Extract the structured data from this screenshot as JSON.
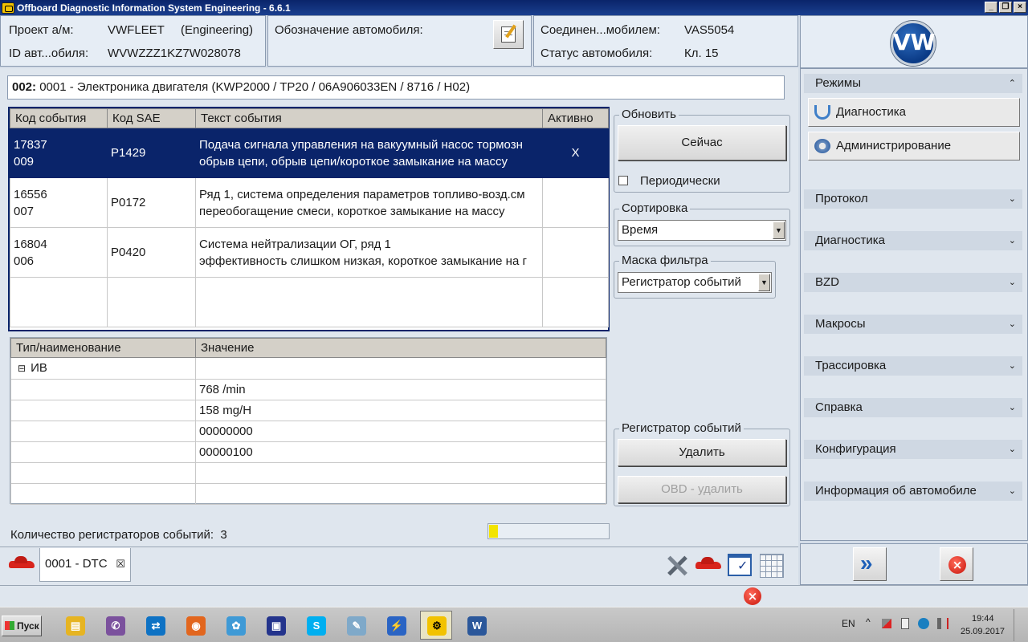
{
  "window": {
    "title": "Offboard Diagnostic Information System Engineering - 6.6.1",
    "controls": [
      "_",
      "❐",
      "×"
    ]
  },
  "header": {
    "project_label": "Проект а/м:",
    "project_value": "VWFLEET",
    "project_mode": "(Engineering)",
    "vin_label": "ID авт...обиля:",
    "vin_value": "WVWZZZ1KZ7W028078",
    "designation_label": "Обозначение автомобиля:",
    "connection_label": "Соединен...мобилем:",
    "connection_value": "VAS5054",
    "status_label": "Статус автомобиля:",
    "status_value": "Кл. 15",
    "logo_text": "VW"
  },
  "ecu": {
    "address": "002:",
    "description": "0001 - Электроника двигателя  (KWP2000 / TP20 / 06A906033EN  / 8716 / H02)"
  },
  "events_table": {
    "columns": [
      "Код события",
      "Код SAE",
      "Текст события",
      "Активно"
    ],
    "rows": [
      {
        "code1": "17837",
        "code2": "009",
        "sae": "P1429",
        "text1": "Подача сигнала управления на вакуумный насос тормозн",
        "text2": "обрыв цепи, обрыв цепи/короткое замыкание на массу",
        "active": "X"
      },
      {
        "code1": "16556",
        "code2": "007",
        "sae": "P0172",
        "text1": "Ряд 1, система определения параметров топливо-возд.см",
        "text2": "переобогащение смеси, короткое замыкание на массу",
        "active": ""
      },
      {
        "code1": "16804",
        "code2": "006",
        "sae": "P0420",
        "text1": "Система нейтрализации ОГ, ряд 1",
        "text2": "эффективность слишком низкая, короткое замыкание на г",
        "active": ""
      }
    ]
  },
  "details_table": {
    "columns": [
      "Тип/наименование",
      "Значение"
    ],
    "group_toggle": "⊟",
    "group_label": "ИВ",
    "values": [
      "768 /min",
      "158 mg/H",
      "00000000",
      "00000100"
    ]
  },
  "controls": {
    "refresh_group": "Обновить",
    "refresh_now": "Сейчас",
    "periodic_label": "Периодически",
    "sort_group": "Сортировка",
    "sort_value": "Время",
    "filter_group": "Маска фильтра",
    "filter_value": "Регистратор событий",
    "logger_group": "Регистратор событий",
    "delete_button": "Удалить",
    "obd_delete_button": "OBD - удалить",
    "combo_arrow": "▼"
  },
  "footer": {
    "count_label": "Количество регистраторов событий:",
    "count_value": "3",
    "progress_percent": 7,
    "tab_label": "0001 - DTC",
    "tab_close": "☒"
  },
  "sidebar": {
    "modes_header": "Режимы",
    "collapse_glyph": "⌃",
    "expand_glyph": "⌄",
    "mode_items": [
      "Диагностика",
      "Администрирование"
    ],
    "sections": [
      "Протокол",
      "Диагностика",
      "BZD",
      "Макросы",
      "Трассировка",
      "Справка",
      "Конфигурация",
      "Информация об автомобиле"
    ],
    "forward_glyph": "»",
    "close_glyph": "×"
  },
  "taskbar": {
    "start_label": "Пуск",
    "apps": [
      {
        "name": "explorer",
        "color": "#e6b422",
        "glyph": "▤"
      },
      {
        "name": "viber",
        "color": "#7b519d",
        "glyph": "✆"
      },
      {
        "name": "teamviewer",
        "color": "#0e72c4",
        "glyph": "⇄"
      },
      {
        "name": "firefox",
        "color": "#e2661e",
        "glyph": "◉"
      },
      {
        "name": "network",
        "color": "#3f9ad6",
        "glyph": "✿"
      },
      {
        "name": "save",
        "color": "#24348c",
        "glyph": "▣"
      },
      {
        "name": "skype",
        "color": "#00aff0",
        "glyph": "S"
      },
      {
        "name": "notepad",
        "color": "#7fa9c9",
        "glyph": "✎"
      },
      {
        "name": "flash",
        "color": "#2a64c4",
        "glyph": "⚡"
      },
      {
        "name": "odis",
        "color": "#f2c200",
        "glyph": "⚙"
      },
      {
        "name": "word",
        "color": "#2b579a",
        "glyph": "W"
      }
    ],
    "language": "EN",
    "tray_up": "^",
    "time": "19:44",
    "date": "25.09.2017"
  }
}
